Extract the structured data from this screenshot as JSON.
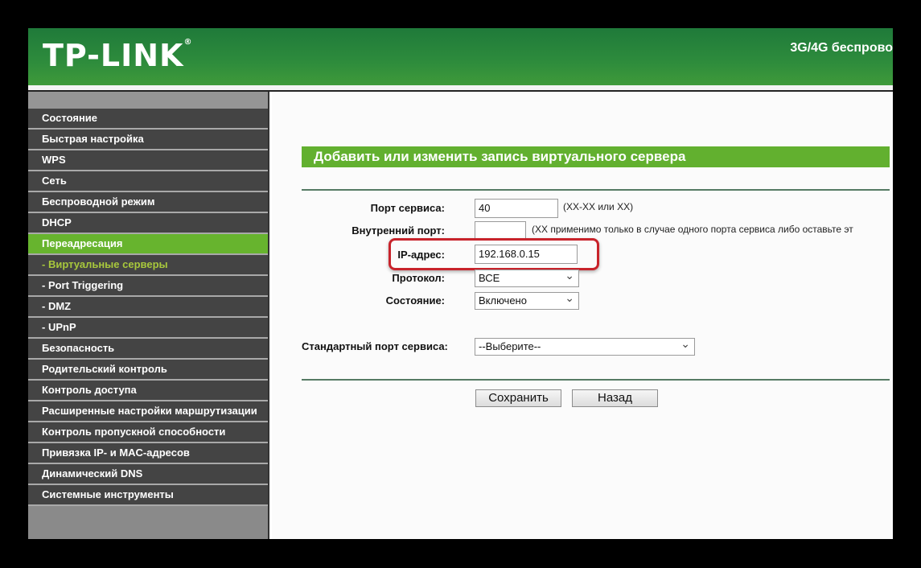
{
  "header": {
    "logo": "TP-LINK",
    "model": "3G/4G беспрово"
  },
  "sidebar": {
    "items": [
      {
        "label": "Состояние"
      },
      {
        "label": "Быстрая настройка"
      },
      {
        "label": "WPS"
      },
      {
        "label": "Сеть"
      },
      {
        "label": "Беспроводной режим"
      },
      {
        "label": "DHCP"
      },
      {
        "label": "Переадресация"
      },
      {
        "label": "- Виртуальные серверы"
      },
      {
        "label": "- Port Triggering"
      },
      {
        "label": "- DMZ"
      },
      {
        "label": "- UPnP"
      },
      {
        "label": "Безопасность"
      },
      {
        "label": "Родительский контроль"
      },
      {
        "label": "Контроль доступа"
      },
      {
        "label": "Расширенные настройки маршрутизации"
      },
      {
        "label": "Контроль пропускной способности"
      },
      {
        "label": "Привязка IP- и MAC-адресов"
      },
      {
        "label": "Динамический DNS"
      },
      {
        "label": "Системные инструменты"
      }
    ]
  },
  "form": {
    "title": "Добавить или изменить запись виртуального сервера",
    "service_port": {
      "label": "Порт сервиса:",
      "value": "40",
      "hint": "(XX-XX или XX)"
    },
    "internal_port": {
      "label": "Внутренний порт:",
      "value": "",
      "hint": "(XX применимо только в случае одного порта сервиса либо оставьте эт"
    },
    "ip": {
      "label": "IP-адрес:",
      "value": "192.168.0.15"
    },
    "protocol": {
      "label": "Протокол:",
      "value": "ВСЕ"
    },
    "status": {
      "label": "Состояние:",
      "value": "Включено"
    },
    "std_port": {
      "label": "Стандартный порт сервиса:",
      "value": "--Выберите--"
    },
    "save": "Сохранить",
    "back": "Назад"
  },
  "colors": {
    "brand_green": "#2e8c3c",
    "active_item": "#67b42e",
    "highlight": "#c8232b"
  }
}
